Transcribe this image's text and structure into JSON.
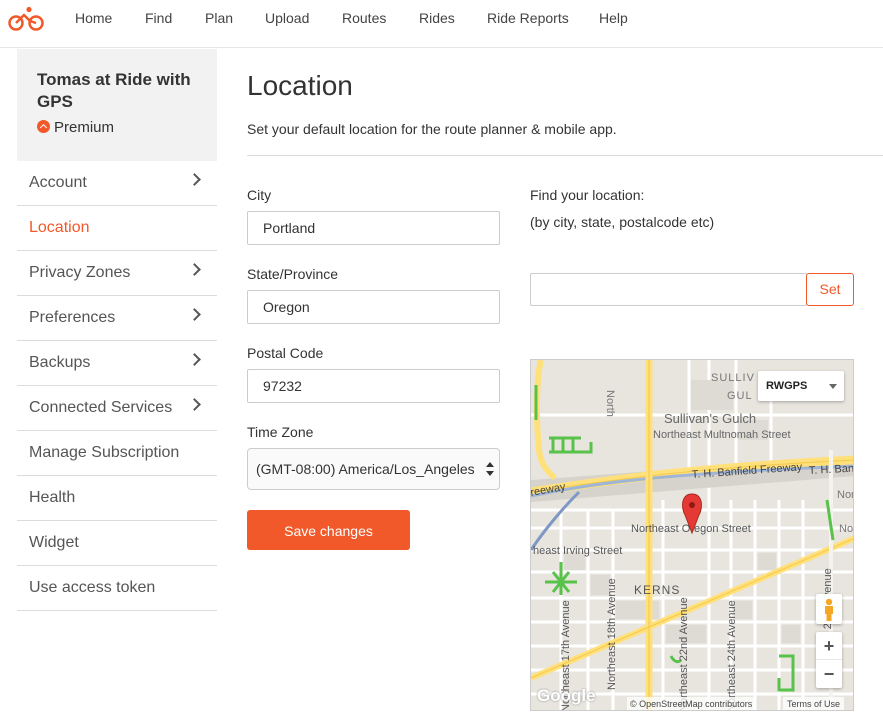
{
  "nav": {
    "items": [
      "Home",
      "Find",
      "Plan",
      "Upload",
      "Routes",
      "Rides",
      "Ride Reports",
      "Help"
    ],
    "logo_icon": "cyclist-logo-icon",
    "accent": "#f2592a"
  },
  "sidebar": {
    "user_name": "Tomas at Ride with GPS",
    "premium_label": "Premium",
    "items": [
      {
        "label": "Account",
        "chevron": true
      },
      {
        "label": "Location",
        "chevron": false,
        "active": true
      },
      {
        "label": "Privacy Zones",
        "chevron": true
      },
      {
        "label": "Preferences",
        "chevron": true
      },
      {
        "label": "Backups",
        "chevron": true
      },
      {
        "label": "Connected Services",
        "chevron": true
      },
      {
        "label": "Manage Subscription",
        "chevron": false
      },
      {
        "label": "Health",
        "chevron": false
      },
      {
        "label": "Widget",
        "chevron": false
      },
      {
        "label": "Use access token",
        "chevron": false
      }
    ]
  },
  "main": {
    "title": "Location",
    "subtitle": "Set your default location for the route planner & mobile app.",
    "form": {
      "city_label": "City",
      "city_value": "Portland",
      "state_label": "State/Province",
      "state_value": "Oregon",
      "postal_label": "Postal Code",
      "postal_value": "97232",
      "timezone_label": "Time Zone",
      "timezone_value": "(GMT-08:00) America/Los_Angeles",
      "save_label": "Save changes"
    },
    "finder": {
      "label": "Find your location:",
      "hint": "(by city, state, postalcode etc)",
      "input_value": "",
      "set_label": "Set"
    }
  },
  "map": {
    "type_selector": "RWGPS",
    "labels": {
      "sullivan_top": "SULLIV",
      "sullivan_gulch_short": "GUL",
      "sullivans_gulch": "Sullivan's Gulch",
      "ne_multnomah": "Northeast Multnomah Street",
      "banfield": "T. H. Banfield Freeway",
      "banfield_right": "T. H. Ban",
      "freeway": "reeway",
      "ne_oregon": "Northeast Oregon Street",
      "irving": "heast Irving Street",
      "kerns": "KERNS",
      "ne_18th": "Northeast 18th Avenue",
      "ne_17th": "Northeast 17th Avenue",
      "ne_22nd": "Northeast 22nd Avenue",
      "ne_24th": "Northeast 24th Avenue",
      "ne_28th": "Northeast 28th Avenue",
      "north_top": "North",
      "north_right": "Nor",
      "no_right": "No"
    },
    "zoom_in": "+",
    "zoom_out": "−",
    "google": "Google",
    "attribution": "© OpenStreetMap contributors",
    "terms": "Terms of Use"
  }
}
